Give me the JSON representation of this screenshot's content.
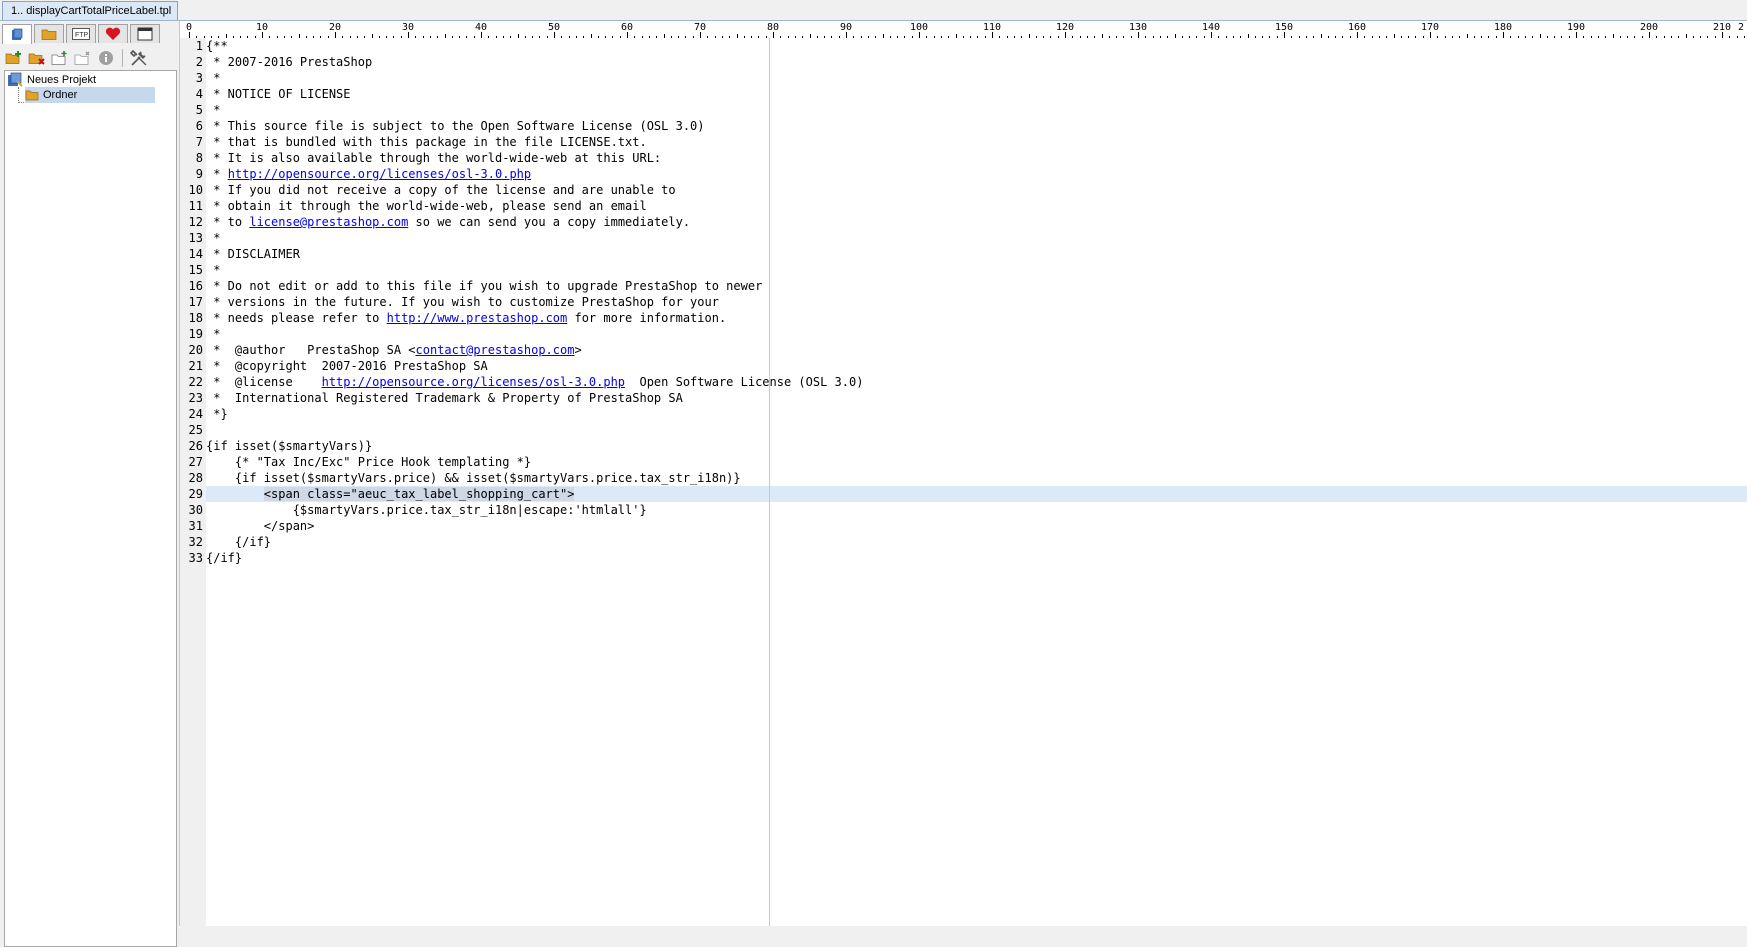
{
  "file_tab": {
    "label": "1.. displayCartTotalPriceLabel.tpl"
  },
  "project_panel": {
    "tabs": [
      {
        "name": "project-tab",
        "icon": "project-icon"
      },
      {
        "name": "explorer-tab",
        "icon": "folder-icon"
      },
      {
        "name": "ftp-tab",
        "icon": "ftp-icon",
        "label": "FTP"
      },
      {
        "name": "favorites-tab",
        "icon": "heart-icon"
      },
      {
        "name": "windows-tab",
        "icon": "window-icon"
      }
    ],
    "tools": [
      "add-folder-icon",
      "remove-folder-icon",
      "new-folder-icon",
      "delete-folder-icon",
      "info-icon",
      "settings-icon"
    ],
    "tree": {
      "project": "Neues Projekt",
      "folder": "Ordner"
    }
  },
  "ruler": {
    "labels": [
      "0",
      "10",
      "20",
      "30",
      "40",
      "50",
      "60",
      "70",
      "80",
      "90",
      "100",
      "110",
      "120",
      "130",
      "140",
      "150",
      "160",
      "170",
      "180",
      "190",
      "200",
      "210",
      "2"
    ]
  },
  "editor": {
    "current_line": 29,
    "lines": [
      {
        "n": "1",
        "parts": [
          {
            "t": "{**"
          }
        ]
      },
      {
        "n": "2",
        "parts": [
          {
            "t": " * 2007-2016 PrestaShop"
          }
        ]
      },
      {
        "n": "3",
        "parts": [
          {
            "t": " *"
          }
        ]
      },
      {
        "n": "4",
        "parts": [
          {
            "t": " * NOTICE OF LICENSE"
          }
        ]
      },
      {
        "n": "5",
        "parts": [
          {
            "t": " *"
          }
        ]
      },
      {
        "n": "6",
        "parts": [
          {
            "t": " * This source file is subject to the Open Software License (OSL 3.0)"
          }
        ]
      },
      {
        "n": "7",
        "parts": [
          {
            "t": " * that is bundled with this package in the file LICENSE.txt."
          }
        ]
      },
      {
        "n": "8",
        "parts": [
          {
            "t": " * It is also available through the world-wide-web at this URL:"
          }
        ]
      },
      {
        "n": "9",
        "parts": [
          {
            "t": " * "
          },
          {
            "t": "http://opensource.org/licenses/osl-3.0.php",
            "link": true
          }
        ]
      },
      {
        "n": "10",
        "parts": [
          {
            "t": " * If you did not receive a copy of the license and are unable to"
          }
        ]
      },
      {
        "n": "11",
        "parts": [
          {
            "t": " * obtain it through the world-wide-web, please send an email"
          }
        ]
      },
      {
        "n": "12",
        "parts": [
          {
            "t": " * to "
          },
          {
            "t": "license@prestashop.com",
            "link": true
          },
          {
            "t": " so we can send you a copy immediately."
          }
        ]
      },
      {
        "n": "13",
        "parts": [
          {
            "t": " *"
          }
        ]
      },
      {
        "n": "14",
        "parts": [
          {
            "t": " * DISCLAIMER"
          }
        ]
      },
      {
        "n": "15",
        "parts": [
          {
            "t": " *"
          }
        ]
      },
      {
        "n": "16",
        "parts": [
          {
            "t": " * Do not edit or add to this file if you wish to upgrade PrestaShop to newer"
          }
        ]
      },
      {
        "n": "17",
        "parts": [
          {
            "t": " * versions in the future. If you wish to customize PrestaShop for your"
          }
        ]
      },
      {
        "n": "18",
        "parts": [
          {
            "t": " * needs please refer to "
          },
          {
            "t": "http://www.prestashop.com",
            "link": true
          },
          {
            "t": " for more information."
          }
        ]
      },
      {
        "n": "19",
        "parts": [
          {
            "t": " *"
          }
        ]
      },
      {
        "n": "20",
        "parts": [
          {
            "t": " *  @author   PrestaShop SA <"
          },
          {
            "t": "contact@prestashop.com",
            "link": true
          },
          {
            "t": ">"
          }
        ]
      },
      {
        "n": "21",
        "parts": [
          {
            "t": " *  @copyright  2007-2016 PrestaShop SA"
          }
        ]
      },
      {
        "n": "22",
        "parts": [
          {
            "t": " *  @license    "
          },
          {
            "t": "http://opensource.org/licenses/osl-3.0.php",
            "link": true
          },
          {
            "t": "  Open Software License (OSL 3.0)"
          }
        ]
      },
      {
        "n": "23",
        "parts": [
          {
            "t": " *  International Registered Trademark & Property of PrestaShop SA"
          }
        ]
      },
      {
        "n": "24",
        "parts": [
          {
            "t": " *}"
          }
        ]
      },
      {
        "n": "25",
        "parts": [
          {
            "t": ""
          }
        ]
      },
      {
        "n": "26",
        "parts": [
          {
            "t": "{if isset($smartyVars)}"
          }
        ]
      },
      {
        "n": "27",
        "parts": [
          {
            "t": "    {* \"Tax Inc/Exc\" Price Hook templating *}"
          }
        ]
      },
      {
        "n": "28",
        "parts": [
          {
            "t": "    {if isset($smartyVars.price) && isset($smartyVars.price.tax_str_i18n)}"
          }
        ]
      },
      {
        "n": "29",
        "parts": [
          {
            "t": "        "
          },
          {
            "t": "<span class=\"aeuc_tax_label_shopping_cart\">",
            "sel": true
          }
        ]
      },
      {
        "n": "30",
        "parts": [
          {
            "t": "            {$smartyVars.price.tax_str_i18n|escape:'htmlall'}"
          }
        ]
      },
      {
        "n": "31",
        "parts": [
          {
            "t": "        </span>"
          }
        ]
      },
      {
        "n": "32",
        "parts": [
          {
            "t": "    {/if}"
          }
        ]
      },
      {
        "n": "33",
        "parts": [
          {
            "t": "{/if}"
          }
        ]
      }
    ]
  }
}
